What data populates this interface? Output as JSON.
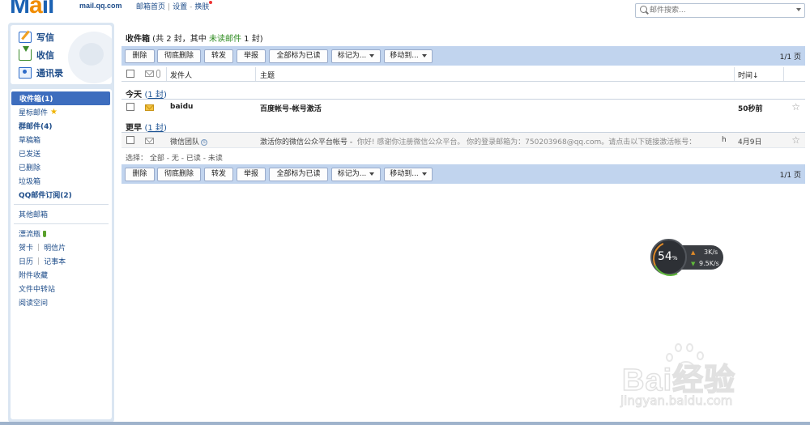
{
  "header": {
    "logo": "Mail",
    "logo_sub": "mail.qq.com",
    "nav_home": "邮箱首页",
    "nav_sep": "|",
    "nav_settings": "设置",
    "nav_dash": "-",
    "nav_skin": "换肤"
  },
  "search": {
    "placeholder": "邮件搜索..."
  },
  "sidebar": {
    "compose": "写信",
    "inbox": "收信",
    "contacts": "通讯录",
    "folders": [
      {
        "label": "收件箱(1)",
        "active": true,
        "bold": true
      },
      {
        "label": "星标邮件",
        "star": true
      },
      {
        "label": "群邮件(4)",
        "bold": true
      },
      {
        "label": "草稿箱"
      },
      {
        "label": "已发送"
      },
      {
        "label": "已删除"
      },
      {
        "label": "垃圾箱"
      },
      {
        "label": "QQ邮件订阅(2)",
        "bold": true
      }
    ],
    "other_mailbox": "其他邮箱",
    "drift_bottle": "漂流瓶",
    "greeting_card": "贺卡",
    "postcard": "明信片",
    "calendar": "日历",
    "notebook": "记事本",
    "attachments": "附件收藏",
    "file_transfer": "文件中转站",
    "reading": "阅读空间"
  },
  "main": {
    "title_prefix": "收件箱",
    "title_mid": " (共 2 封，其中 ",
    "title_unread": "未读邮件",
    "title_suffix": " 1 封)",
    "toolbar": {
      "delete": "删除",
      "perm_delete": "彻底删除",
      "forward": "转发",
      "report": "举报",
      "mark_all_read": "全部标为已读",
      "mark_as": "标记为...",
      "move_to": "移动到..."
    },
    "pager": "1/1 页",
    "columns": {
      "sender": "发件人",
      "subject": "主题",
      "time": "时间↓"
    },
    "groups": [
      {
        "label": "今天",
        "count_open": "(",
        "count": "1 封",
        "count_close": ")",
        "mails": [
          {
            "sender": "baidu",
            "subject": "百度帐号-帐号激活",
            "preview": "",
            "time": "50秒前",
            "unread": true
          }
        ]
      },
      {
        "label": "更早",
        "count_open": "(",
        "count": "1 封",
        "count_close": ")",
        "mails": [
          {
            "sender": "微信团队",
            "verified": "⑤",
            "subject": "激活你的微信公众平台帐号 -",
            "preview": "你好! 感谢你注册微信公众平台。 你的登录邮箱为：750203968@qq.com。请点击以下链接激活帐号：",
            "trailing": "h",
            "time": "4月9日",
            "unread": false
          }
        ]
      }
    ],
    "select": {
      "prefix": "选择：",
      "all": "全部",
      "none": "无",
      "read": "已读",
      "unread": "未读",
      "dash": " - "
    }
  },
  "speed_widget": {
    "percent": "54",
    "percent_sign": "%",
    "upload": "3K/s",
    "download": "9.5K/s"
  },
  "watermark": {
    "text": "Bai经验",
    "du": "du",
    "sub": "jingyan.baidu.com"
  },
  "colors": {
    "accent": "#3d6dbe",
    "toolbar": "#c1d4ee",
    "unread_green": "#2e8b20"
  }
}
